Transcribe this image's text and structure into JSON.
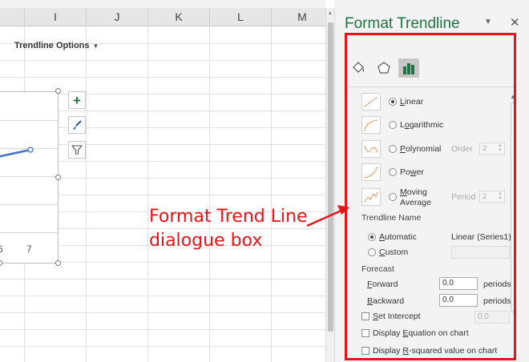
{
  "sheet": {
    "columns": [
      "I",
      "J",
      "K",
      "L",
      "M"
    ],
    "chart": {
      "visible_x_ticks": [
        "6",
        "7"
      ]
    },
    "chart_buttons": [
      "chart-elements-button",
      "chart-styles-button",
      "chart-filters-button"
    ]
  },
  "pane": {
    "title": "Format Trendline",
    "options_header": "Trendline Options",
    "tabs": [
      "fill-line-icon",
      "effects-icon",
      "trendline-options-icon"
    ],
    "trendline_types": [
      {
        "label": "Linear",
        "ul": "L",
        "rest": "inear",
        "selected": true
      },
      {
        "label": "Logarithmic",
        "ul": "o",
        "pre": "L",
        "rest": "garithmic",
        "selected": false
      },
      {
        "label": "Polynomial",
        "ul": "P",
        "rest": "olynomial",
        "selected": false
      },
      {
        "label": "Power",
        "ul": "w",
        "pre": "Po",
        "rest": "er",
        "selected": false
      },
      {
        "label": "Moving Average",
        "ul": "M",
        "rest": "oving",
        "line2": "Average",
        "selected": false
      }
    ],
    "order_label": "Order",
    "order_value": "2",
    "period_label": "Period",
    "period_value": "2",
    "trendline_name_section": "Trendline Name",
    "automatic_label": "Automatic",
    "automatic_value": "Linear (Series1)",
    "custom_label": "Custom",
    "custom_value": "",
    "forecast_section": "Forecast",
    "forward_label": "Forward",
    "forward_value": "0.0",
    "backward_label": "Backward",
    "backward_value": "0.0",
    "periods_label": "periods",
    "set_intercept_label": "Set Intercept",
    "set_intercept_value": "0.0",
    "display_equation_label": "Display Equation on chart",
    "display_rsquared_label": "Display R-squared value on chart"
  },
  "annotation": {
    "line1": "Format Trend Line",
    "line2": "dialogue box",
    "color": "#e8141a"
  },
  "colors": {
    "accent": "#217346",
    "trendline": "#4472c4"
  }
}
